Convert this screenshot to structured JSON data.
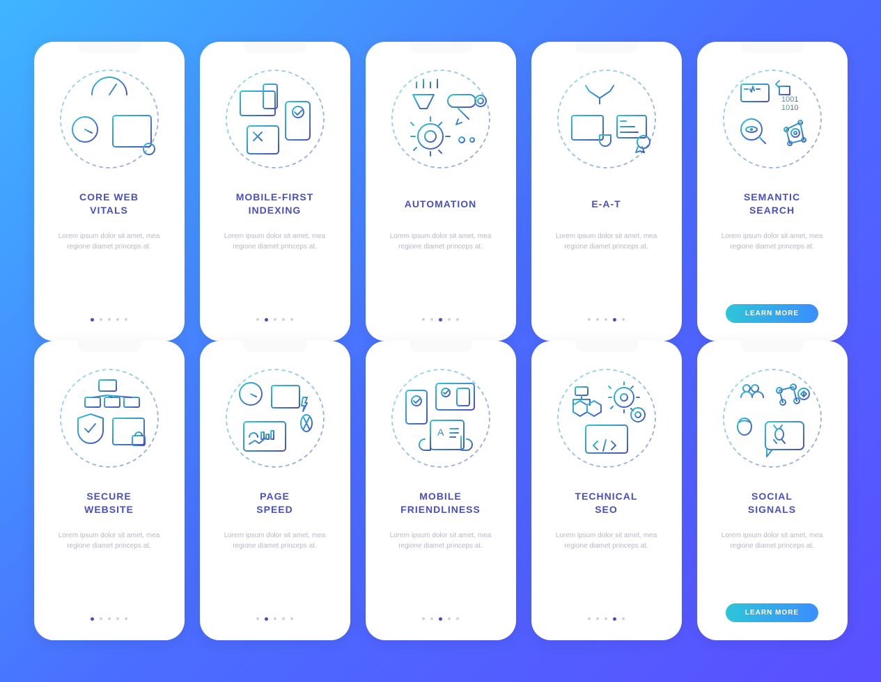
{
  "lorem": "Lorem ipsum dolor sit amet, mea regione diamet princeps at.",
  "button_label": "LEARN MORE",
  "dot_count": 5,
  "rows": [
    {
      "cards": [
        {
          "title": "CORE WEB\nVITALS",
          "icon": "core-web-vitals-icon",
          "active_dot": 0,
          "has_button": false
        },
        {
          "title": "MOBILE-FIRST\nINDEXING",
          "icon": "mobile-first-icon",
          "active_dot": 1,
          "has_button": false
        },
        {
          "title": "AUTOMATION",
          "icon": "automation-icon",
          "active_dot": 2,
          "has_button": false
        },
        {
          "title": "E-A-T",
          "icon": "eat-icon",
          "active_dot": 3,
          "has_button": false
        },
        {
          "title": "SEMANTIC\nSEARCH",
          "icon": "semantic-search-icon",
          "active_dot": -1,
          "has_button": true
        }
      ]
    },
    {
      "cards": [
        {
          "title": "SECURE\nWEBSITE",
          "icon": "secure-website-icon",
          "active_dot": 0,
          "has_button": false
        },
        {
          "title": "PAGE\nSPEED",
          "icon": "page-speed-icon",
          "active_dot": 1,
          "has_button": false
        },
        {
          "title": "MOBILE\nFRIENDLINESS",
          "icon": "mobile-friendly-icon",
          "active_dot": 2,
          "has_button": false
        },
        {
          "title": "TECHNICAL\nSEO",
          "icon": "technical-seo-icon",
          "active_dot": 3,
          "has_button": false
        },
        {
          "title": "SOCIAL\nSIGNALS",
          "icon": "social-signals-icon",
          "active_dot": -1,
          "has_button": true
        }
      ]
    }
  ]
}
